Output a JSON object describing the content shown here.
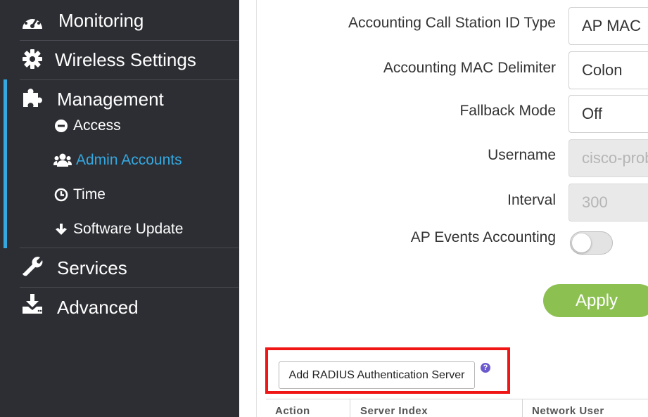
{
  "sidebar": {
    "items": [
      {
        "label": "Monitoring",
        "icon": "dashboard-icon"
      },
      {
        "label": "Wireless Settings",
        "icon": "gear-icon"
      },
      {
        "label": "Management",
        "icon": "puzzle-icon"
      },
      {
        "label": "Services",
        "icon": "wrench-icon"
      },
      {
        "label": "Advanced",
        "icon": "download-icon"
      }
    ],
    "management_sub": [
      {
        "label": "Access",
        "icon": "minus-circle-icon"
      },
      {
        "label": "Admin Accounts",
        "icon": "users-icon"
      },
      {
        "label": "Time",
        "icon": "clock-icon"
      },
      {
        "label": "Software Update",
        "icon": "arrow-down-icon"
      }
    ],
    "active_sub": "Admin Accounts",
    "colors": {
      "background": "#2d2e33",
      "accent": "#35a8e0"
    }
  },
  "form": {
    "fields": [
      {
        "label": "Accounting Call Station ID Type",
        "value": "AP MAC"
      },
      {
        "label": "Accounting MAC Delimiter",
        "value": "Colon"
      },
      {
        "label": "Fallback Mode",
        "value": "Off"
      },
      {
        "label": "Username",
        "value": "cisco-probe",
        "disabled": true
      },
      {
        "label": "Interval",
        "value": "300",
        "disabled": true
      }
    ],
    "ap_events_label": "AP Events Accounting",
    "ap_events_enabled": false,
    "apply_label": "Apply",
    "apply_color": "#8cc152"
  },
  "radius": {
    "add_button_label": "Add RADIUS Authentication Server",
    "help_glyph": "?",
    "highlight_color": "#f01616"
  },
  "table": {
    "headers": [
      "Action",
      "Server Index",
      "Network User"
    ]
  }
}
